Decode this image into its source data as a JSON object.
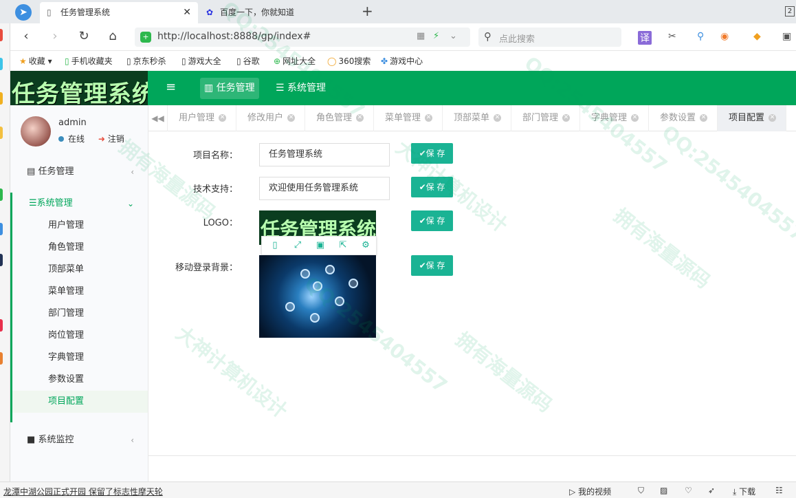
{
  "browser": {
    "active_tab_title": "任务管理系统",
    "inactive_tab_title": "百度一下，你就知道",
    "tab_count": "2",
    "url": "http://localhost:8888/gp/index#",
    "search_placeholder": "点此搜索",
    "translate_label": "译",
    "bookmarks": [
      "收藏",
      "手机收藏夹",
      "京东秒杀",
      "游戏大全",
      "谷歌",
      "网址大全",
      "360搜索",
      "游戏中心"
    ]
  },
  "app": {
    "logo_text": "任务管理系统",
    "header_nav": [
      {
        "label": "任务管理",
        "icon": "bar-chart-icon"
      },
      {
        "label": "系统管理",
        "icon": "list-icon"
      }
    ],
    "user": {
      "name": "admin",
      "status": "在线",
      "logout": "注销"
    },
    "menu": {
      "task_mgmt": "任务管理",
      "sys_mgmt": "系统管理",
      "sys_monitor": "系统监控",
      "sub_items": [
        "用户管理",
        "角色管理",
        "顶部菜单",
        "菜单管理",
        "部门管理",
        "岗位管理",
        "字典管理",
        "参数设置",
        "项目配置"
      ]
    },
    "page_tabs": [
      "用户管理",
      "修改用户",
      "角色管理",
      "菜单管理",
      "顶部菜单",
      "部门管理",
      "字典管理",
      "参数设置",
      "项目配置"
    ],
    "form": {
      "project_name_label": "项目名称：",
      "project_name_value": "任务管理系统",
      "support_label": "技术支持：",
      "support_value": "欢迎使用任务管理系统",
      "logo_label": "LOGO：",
      "mobile_bg_label": "移动登录背景：",
      "save_label": "✔保 存"
    }
  },
  "statusbar": {
    "news": "龙潭中湖公园正式开园 保留了标志性摩天轮",
    "my_video": "我的视频",
    "download": "下载"
  },
  "watermarks": [
    "QQ:2545404557",
    "拥有海量源码",
    "大神计算机设计"
  ],
  "colors": {
    "primary": "#00a65a",
    "button": "#1ab394"
  }
}
